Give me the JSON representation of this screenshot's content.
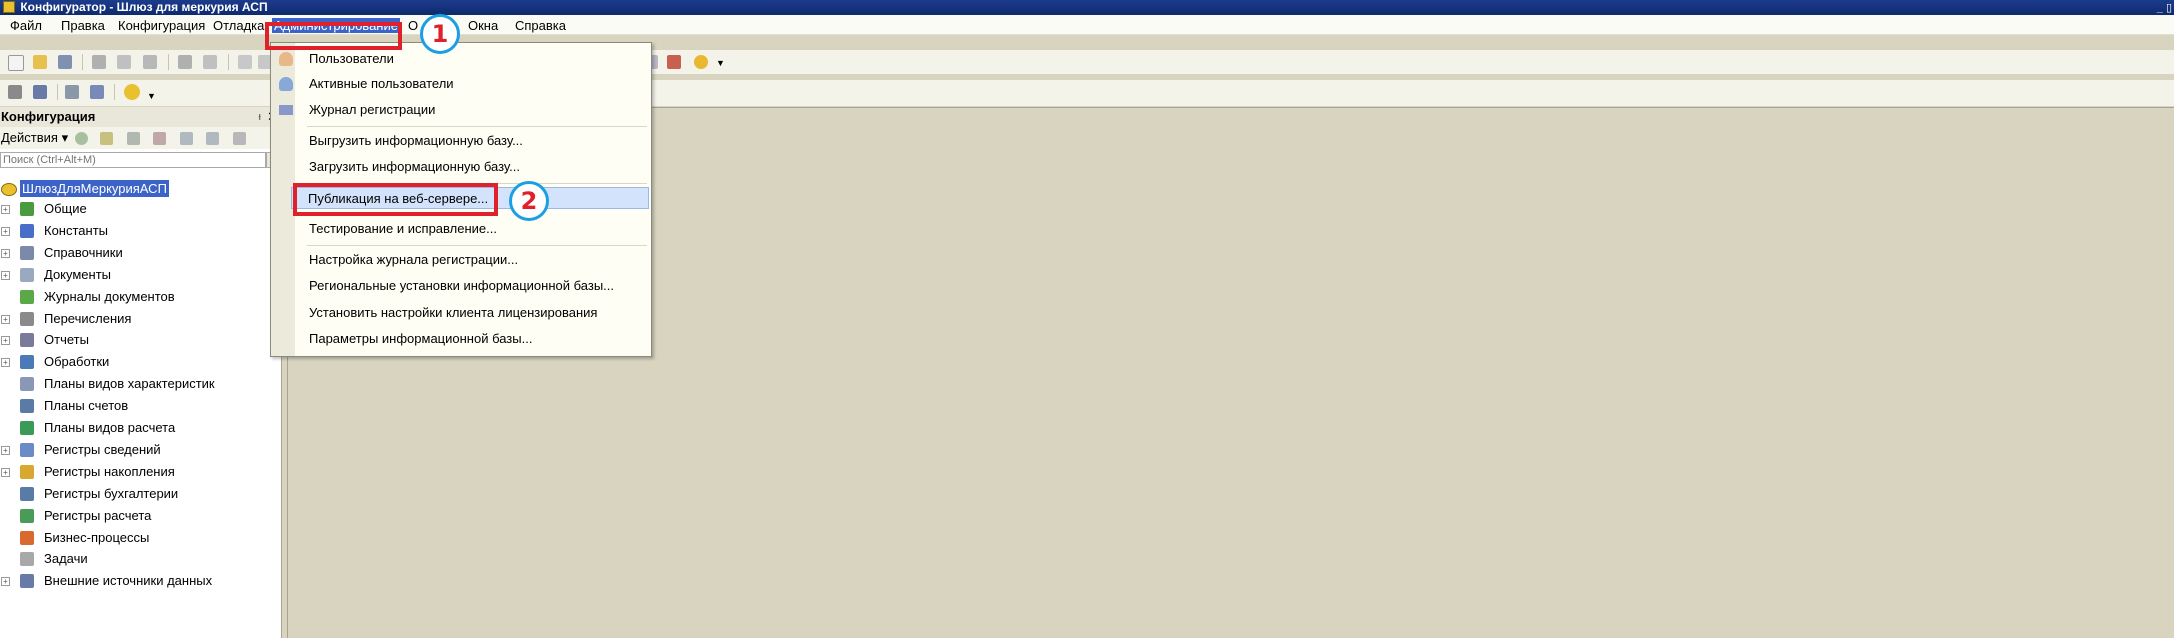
{
  "window": {
    "title": "Конфигуратор - Шлюз для меркурия АСП",
    "controls": "_ ▯"
  },
  "menubar": {
    "items": [
      "Файл",
      "Правка",
      "Конфигурация",
      "Отладка",
      "Администрирование",
      "О",
      "Окна",
      "Справка"
    ]
  },
  "left_panel": {
    "title": "Конфигурация",
    "pin_glyph": "ᵻ",
    "close_glyph": "✕",
    "actions_label": "Действия ▾",
    "search_placeholder": "Поиск (Ctrl+Alt+M)",
    "search_button": "✕",
    "tree": {
      "root": "ШлюзДляМеркурияАСП",
      "items": [
        {
          "label": "Общие",
          "expandable": true,
          "icon_color": "#4a9a40"
        },
        {
          "label": "Константы",
          "expandable": true,
          "icon_color": "#4a6ec8"
        },
        {
          "label": "Справочники",
          "expandable": true,
          "icon_color": "#7a8aa8"
        },
        {
          "label": "Документы",
          "expandable": true,
          "icon_color": "#9aa8c0"
        },
        {
          "label": "Журналы документов",
          "expandable": false,
          "icon_color": "#5aa848"
        },
        {
          "label": "Перечисления",
          "expandable": true,
          "icon_color": "#8a8a8a"
        },
        {
          "label": "Отчеты",
          "expandable": true,
          "icon_color": "#7a7a9a"
        },
        {
          "label": "Обработки",
          "expandable": true,
          "icon_color": "#4a7ab8"
        },
        {
          "label": "Планы видов характеристик",
          "expandable": false,
          "icon_color": "#8a98b8"
        },
        {
          "label": "Планы счетов",
          "expandable": false,
          "icon_color": "#5a7aa8"
        },
        {
          "label": "Планы видов расчета",
          "expandable": false,
          "icon_color": "#3a9a58"
        },
        {
          "label": "Регистры сведений",
          "expandable": true,
          "icon_color": "#6a8ac8"
        },
        {
          "label": "Регистры накопления",
          "expandable": true,
          "icon_color": "#d8a830"
        },
        {
          "label": "Регистры бухгалтерии",
          "expandable": false,
          "icon_color": "#5a7aa8"
        },
        {
          "label": "Регистры расчета",
          "expandable": false,
          "icon_color": "#4a9a58"
        },
        {
          "label": "Бизнес-процессы",
          "expandable": false,
          "icon_color": "#d86a30"
        },
        {
          "label": "Задачи",
          "expandable": false,
          "icon_color": "#a8a8a8"
        },
        {
          "label": "Внешние источники данных",
          "expandable": true,
          "icon_color": "#6a7aa8"
        }
      ]
    }
  },
  "admin_menu": {
    "items": [
      "Пользователи",
      "Активные пользователи",
      "Журнал регистрации",
      "Выгрузить информационную базу...",
      "Загрузить информационную базу...",
      "Публикация на веб-сервере...",
      "Тестирование и исправление...",
      "Настройка журнала регистрации...",
      "Региональные установки информационной базы...",
      "Установить настройки клиента лицензирования",
      "Параметры информационной базы..."
    ]
  },
  "annotations": {
    "step1": "1",
    "step2": "2",
    "accent": "#e0202a",
    "circle_color": "#1b9fe3"
  },
  "colors": {
    "titlebar": "#1c3c8c",
    "highlight": "#3c64c8",
    "workspace": "#d8d4c0"
  }
}
